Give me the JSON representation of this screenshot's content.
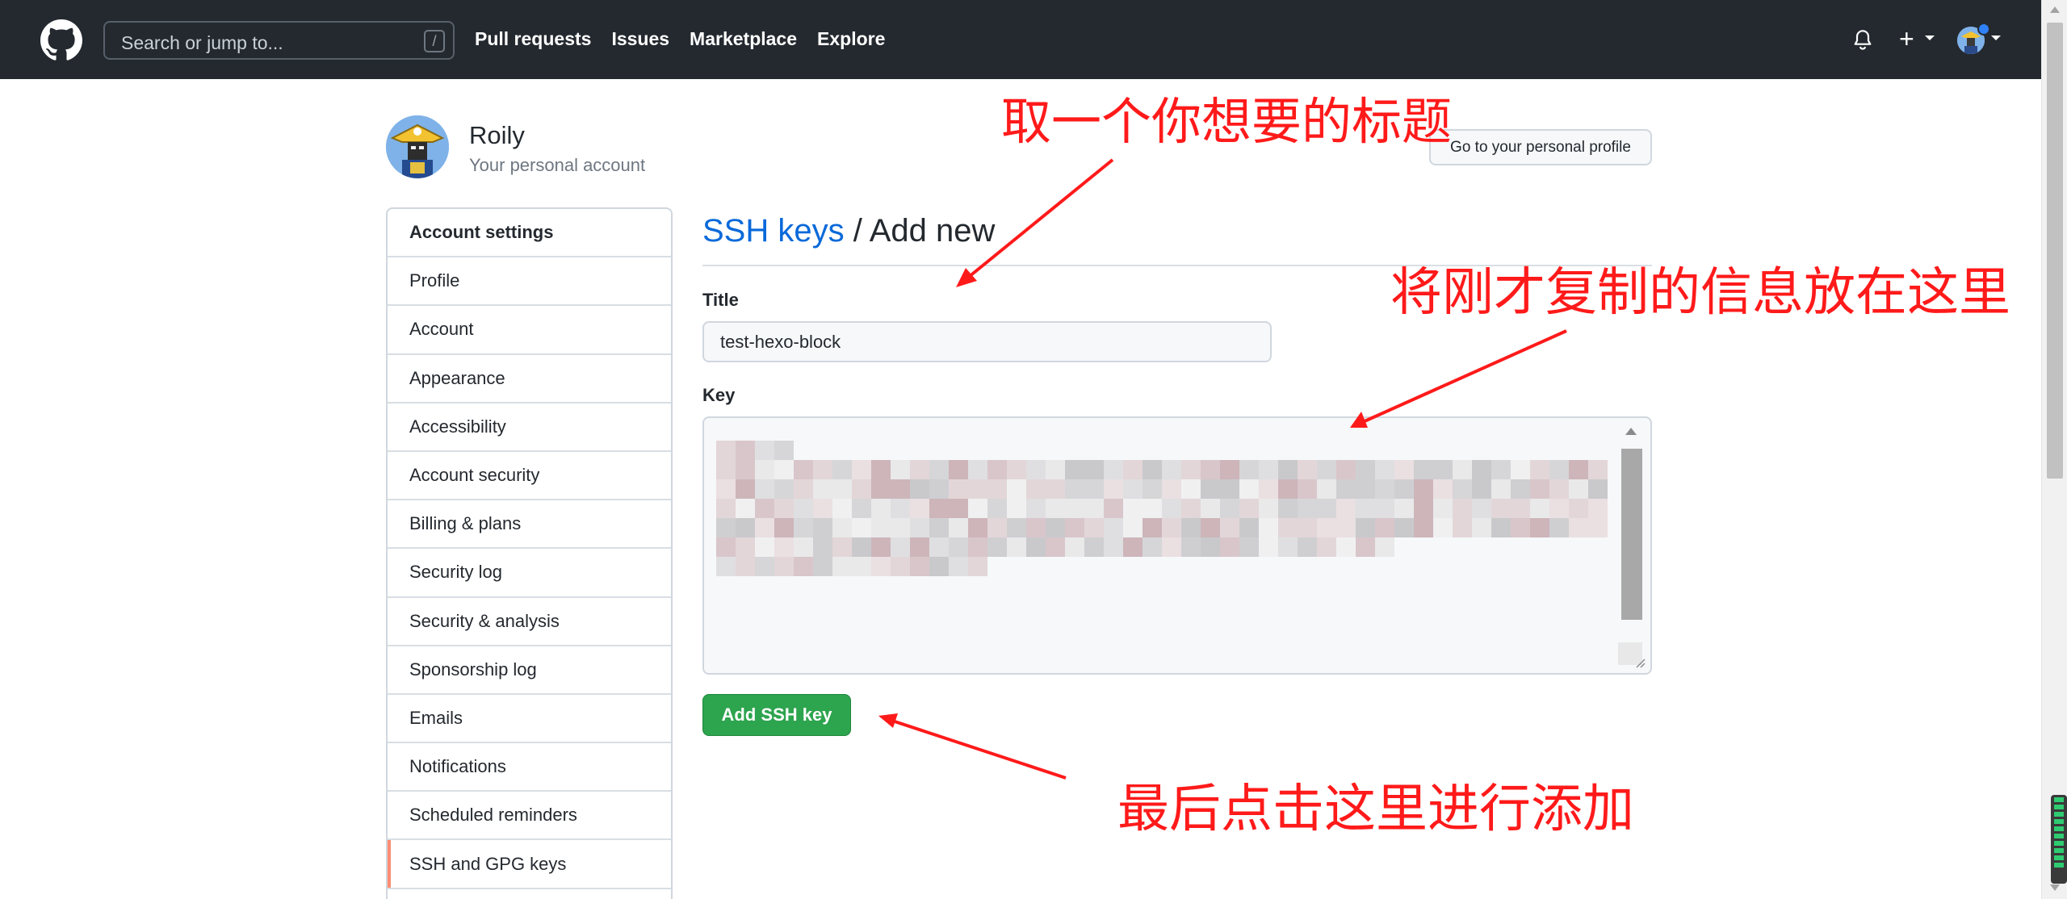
{
  "header": {
    "search_placeholder": "Search or jump to...",
    "search_shortcut": "/",
    "nav": [
      "Pull requests",
      "Issues",
      "Marketplace",
      "Explore"
    ]
  },
  "profile": {
    "name": "Roily",
    "subtitle": "Your personal account",
    "profile_button": "Go to your personal profile"
  },
  "sidebar": {
    "items": [
      {
        "label": "Account settings"
      },
      {
        "label": "Profile"
      },
      {
        "label": "Account"
      },
      {
        "label": "Appearance"
      },
      {
        "label": "Accessibility"
      },
      {
        "label": "Account security"
      },
      {
        "label": "Billing & plans"
      },
      {
        "label": "Security log"
      },
      {
        "label": "Security & analysis"
      },
      {
        "label": "Sponsorship log"
      },
      {
        "label": "Emails"
      },
      {
        "label": "Notifications"
      },
      {
        "label": "Scheduled reminders"
      },
      {
        "label": "SSH and GPG keys"
      }
    ]
  },
  "main": {
    "breadcrumb_link": "SSH keys",
    "breadcrumb_sep": " / ",
    "breadcrumb_current": "Add new",
    "title_label": "Title",
    "title_value": "test-hexo-block",
    "key_label": "Key",
    "submit_label": "Add SSH key"
  },
  "annotations": {
    "title_note": "取一个你想要的标题",
    "key_note": "将刚才复制的信息放在这里",
    "button_note": "最后点击这里进行添加"
  },
  "colors": {
    "header_bg": "#24292f",
    "link": "#0969da",
    "button_green": "#2da44e",
    "selected_marker": "#fd8c73",
    "annotation_red": "#ff1a1a"
  }
}
